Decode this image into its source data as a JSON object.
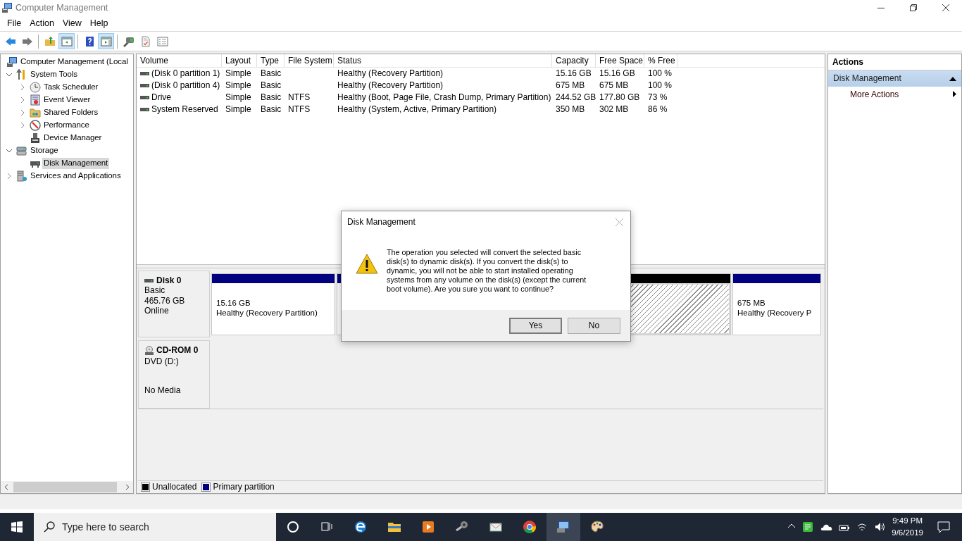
{
  "window": {
    "title": "Computer Management"
  },
  "menu": [
    "File",
    "Action",
    "View",
    "Help"
  ],
  "toolbar": [
    {
      "pressed": false
    },
    {
      "pressed": false
    },
    {
      "pressed": false
    },
    {
      "pressed": true
    },
    {
      "pressed": false
    },
    {
      "pressed": true
    },
    {
      "pressed": false
    },
    {
      "pressed": false
    },
    {
      "pressed": false
    }
  ],
  "tree": [
    {
      "label": "Computer Management (Local",
      "selected": false,
      "children": [
        {
          "label": "System Tools",
          "expanded": true,
          "selected": false,
          "children": [
            {
              "label": "Task Scheduler",
              "expanded": false,
              "selected": false
            },
            {
              "label": "Event Viewer",
              "expanded": false,
              "selected": false
            },
            {
              "label": "Shared Folders",
              "expanded": false,
              "selected": false
            },
            {
              "label": "Performance",
              "expanded": false,
              "selected": false
            },
            {
              "label": "Device Manager",
              "selected": false
            }
          ]
        },
        {
          "label": "Storage",
          "expanded": true,
          "selected": false,
          "children": [
            {
              "label": "Disk Management",
              "selected": true
            }
          ]
        },
        {
          "label": "Services and Applications",
          "expanded": false,
          "selected": false
        }
      ]
    }
  ],
  "volumes": {
    "columns": [
      "Volume",
      "Layout",
      "Type",
      "File System",
      "Status",
      "Capacity",
      "Free Space",
      "% Free"
    ],
    "rows": [
      {
        "cells": [
          "(Disk 0 partition 1)",
          "Simple",
          "Basic",
          "",
          "Healthy (Recovery Partition)",
          "15.16 GB",
          "15.16 GB",
          "100 %"
        ]
      },
      {
        "cells": [
          "(Disk 0 partition 4)",
          "Simple",
          "Basic",
          "",
          "Healthy (Recovery Partition)",
          "675 MB",
          "675 MB",
          "100 %"
        ]
      },
      {
        "cells": [
          "Drive",
          "Simple",
          "Basic",
          "NTFS",
          "Healthy (Boot, Page File, Crash Dump, Primary Partition)",
          "244.52 GB",
          "177.80 GB",
          "73 %"
        ]
      },
      {
        "cells": [
          "System Reserved",
          "Simple",
          "Basic",
          "NTFS",
          "Healthy (System, Active, Primary Partition)",
          "350 MB",
          "302 MB",
          "86 %"
        ]
      }
    ]
  },
  "disks": [
    {
      "kind": "disk",
      "name": "Disk 0",
      "type": "Basic",
      "size": "465.76 GB",
      "status": "Online",
      "partitions": [
        {
          "kind": "primary",
          "selected": false,
          "size": "15.16 GB",
          "status": "Healthy (Recovery Partition)"
        },
        {
          "kind": "primary",
          "selected": false
        },
        {
          "kind": "unallocated",
          "selected": true
        },
        {
          "kind": "primary",
          "selected": false,
          "size": "675 MB",
          "status": "Healthy (Recovery P"
        }
      ]
    },
    {
      "kind": "cdrom",
      "name": "CD-ROM 0",
      "type": "DVD (D:)",
      "status": "No Media"
    }
  ],
  "legend": [
    {
      "label": "Unallocated",
      "color": "#000000"
    },
    {
      "label": "Primary partition",
      "color": "#000080"
    }
  ],
  "actions": {
    "title": "Actions",
    "sections": [
      {
        "label": "Disk Management",
        "expanded": true,
        "items": [
          "More Actions"
        ]
      }
    ]
  },
  "dialog": {
    "title": "Disk Management",
    "message": "The operation you selected will convert the selected basic disk(s) to dynamic disk(s). If you convert the disk(s) to dynamic, you will not be able to start installed operating systems from any volume on the disk(s) (except the current boot volume). Are you sure you want to continue?",
    "buttons": [
      {
        "label": "Yes",
        "default": true
      },
      {
        "label": "No",
        "default": false
      }
    ]
  },
  "taskbar": {
    "search": {
      "placeholder": "Type here to search"
    },
    "apps": [
      {
        "selected": false
      },
      {
        "selected": false
      },
      {
        "selected": false
      },
      {
        "selected": false
      },
      {
        "selected": false
      },
      {
        "selected": false
      },
      {
        "selected": true
      },
      {
        "selected": false
      }
    ],
    "time": "9:49 PM",
    "date": "9/6/2019"
  }
}
